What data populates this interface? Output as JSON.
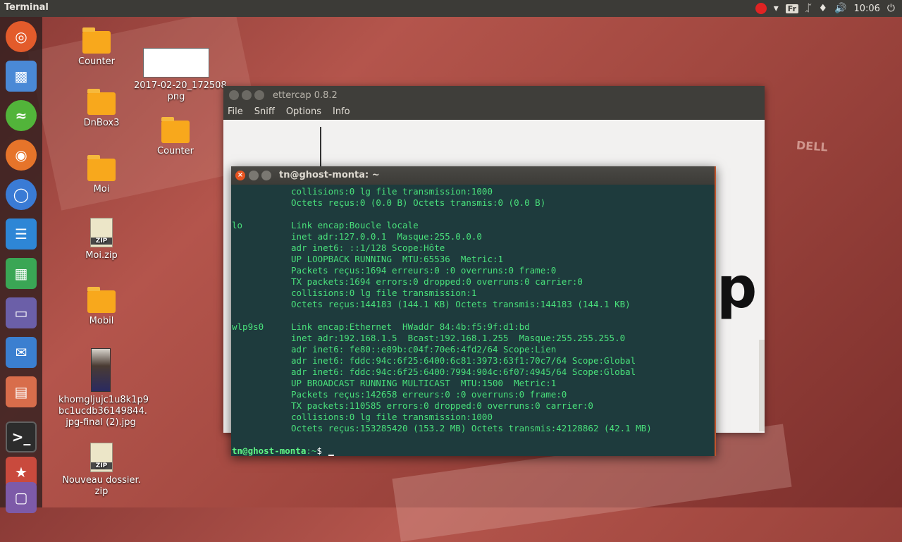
{
  "top_panel": {
    "title": "Terminal",
    "keyboard_layout": "Fr",
    "clock": "10:06"
  },
  "launcher": {
    "items": [
      "ubuntu-dash",
      "software-center",
      "spotify",
      "firefox",
      "chromium",
      "libreoffice-writer",
      "libreoffice-calc",
      "files",
      "pidgin",
      "app-stack",
      "terminal",
      "multi-app",
      "app-bottom"
    ]
  },
  "desktop": {
    "icons": [
      {
        "label": "Counter",
        "type": "folder"
      },
      {
        "label": "2017-02-20_172508.\npng",
        "type": "image"
      },
      {
        "label": "DnBox3",
        "type": "folder"
      },
      {
        "label": "Counter",
        "type": "folder"
      },
      {
        "label": "Moi",
        "type": "folder"
      },
      {
        "label": "Moi.zip",
        "type": "zip"
      },
      {
        "label": "Mobil",
        "type": "folder"
      },
      {
        "label": "khomgljujc1u8k1p9\nbc1ucdb36149844.\njpg-final (2).jpg",
        "type": "photo"
      },
      {
        "label": "Nouveau dossier.\nzip",
        "type": "zip"
      }
    ],
    "zip_badge": "ZIP",
    "wallpaper_brand": "DELL"
  },
  "ettercap": {
    "title": "ettercap 0.8.2",
    "menu": [
      "File",
      "Sniff",
      "Options",
      "Info"
    ],
    "logo_suffix": "p"
  },
  "terminal": {
    "title": "tn@ghost-monta: ~",
    "lines": [
      {
        "iface": "",
        "text": "collisions:0 lg file transmission:1000"
      },
      {
        "iface": "",
        "text": "Octets reçus:0 (0.0 B) Octets transmis:0 (0.0 B)"
      },
      {
        "iface": "",
        "text": ""
      },
      {
        "iface": "lo",
        "text": "Link encap:Boucle locale"
      },
      {
        "iface": "",
        "text": "inet adr:127.0.0.1  Masque:255.0.0.0"
      },
      {
        "iface": "",
        "text": "adr inet6: ::1/128 Scope:Hôte"
      },
      {
        "iface": "",
        "text": "UP LOOPBACK RUNNING  MTU:65536  Metric:1"
      },
      {
        "iface": "",
        "text": "Packets reçus:1694 erreurs:0 :0 overruns:0 frame:0"
      },
      {
        "iface": "",
        "text": "TX packets:1694 errors:0 dropped:0 overruns:0 carrier:0"
      },
      {
        "iface": "",
        "text": "collisions:0 lg file transmission:1"
      },
      {
        "iface": "",
        "text": "Octets reçus:144183 (144.1 KB) Octets transmis:144183 (144.1 KB)"
      },
      {
        "iface": "",
        "text": ""
      },
      {
        "iface": "wlp9s0",
        "text": "Link encap:Ethernet  HWaddr 84:4b:f5:9f:d1:bd"
      },
      {
        "iface": "",
        "text": "inet adr:192.168.1.5  Bcast:192.168.1.255  Masque:255.255.255.0"
      },
      {
        "iface": "",
        "text": "adr inet6: fe80::e89b:c04f:70e6:4fd2/64 Scope:Lien"
      },
      {
        "iface": "",
        "text": "adr inet6: fddc:94c:6f25:6400:6c81:3973:63f1:70c7/64 Scope:Global"
      },
      {
        "iface": "",
        "text": "adr inet6: fddc:94c:6f25:6400:7994:904c:6f07:4945/64 Scope:Global"
      },
      {
        "iface": "",
        "text": "UP BROADCAST RUNNING MULTICAST  MTU:1500  Metric:1"
      },
      {
        "iface": "",
        "text": "Packets reçus:142658 erreurs:0 :0 overruns:0 frame:0"
      },
      {
        "iface": "",
        "text": "TX packets:110585 errors:0 dropped:0 overruns:0 carrier:0"
      },
      {
        "iface": "",
        "text": "collisions:0 lg file transmission:1000"
      },
      {
        "iface": "",
        "text": "Octets reçus:153285420 (153.2 MB) Octets transmis:42128862 (42.1 MB)"
      }
    ],
    "prompt_user": "tn@ghost-monta",
    "prompt_path": ":~",
    "prompt_symbol": "$"
  }
}
